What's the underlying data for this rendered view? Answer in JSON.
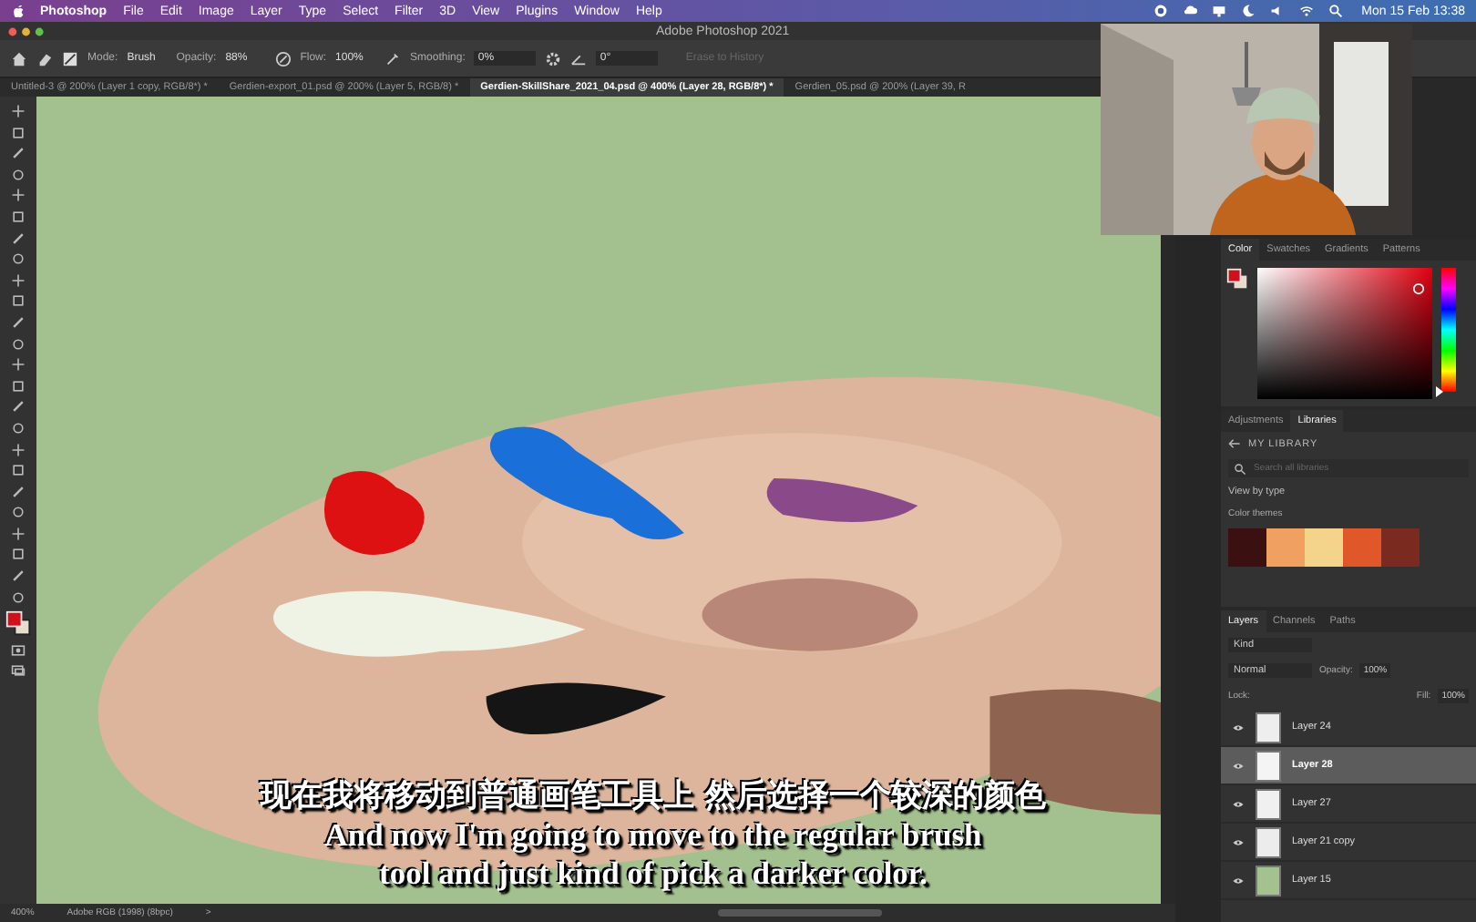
{
  "menu_bar": {
    "app": "Photoshop",
    "items": [
      "File",
      "Edit",
      "Image",
      "Layer",
      "Type",
      "Select",
      "Filter",
      "3D",
      "View",
      "Plugins",
      "Window",
      "Help"
    ],
    "clock": "Mon 15 Feb  13:38"
  },
  "window": {
    "title": "Adobe Photoshop 2021"
  },
  "options_bar": {
    "mode_label": "Mode:",
    "mode": "Brush",
    "opacity_label": "Opacity:",
    "opacity": "88%",
    "flow_label": "Flow:",
    "flow": "100%",
    "smoothing_label": "Smoothing:",
    "smoothing": "0%",
    "angle": "0°",
    "history": {
      "label": "Erase to History",
      "disabled": true
    }
  },
  "doc_tabs": [
    {
      "label": "Untitled-3 @ 200% (Layer 1 copy, RGB/8*) *",
      "selected": false
    },
    {
      "label": "Gerdien-export_01.psd @ 200% (Layer 5, RGB/8) *",
      "selected": false
    },
    {
      "label": "Gerdien-SkillShare_2021_04.psd @ 400% (Layer 28, RGB/8*) *",
      "selected": true
    },
    {
      "label": "Gerdien_05.psd @ 200% (Layer 39, R",
      "selected": false
    }
  ],
  "subtitles": [
    "现在我将移动到普通画笔工具上 然后选择一个较深的颜色",
    "And now I'm going to move to the regular brush",
    "tool and just kind of pick a darker color."
  ],
  "status_bar": {
    "zoom": "400%",
    "profile": "Adobe RGB (1998) (8bpc)",
    "arrow": ">"
  },
  "color_panel": {
    "tabs": [
      {
        "label": "Color",
        "selected": true
      },
      {
        "label": "Swatches",
        "selected": false
      },
      {
        "label": "Gradients",
        "selected": false
      },
      {
        "label": "Patterns",
        "selected": false
      }
    ],
    "hue": {
      "level": 0
    }
  },
  "libraries_panel": {
    "tabs": [
      {
        "label": "Adjustments",
        "selected": false
      },
      {
        "label": "Libraries",
        "selected": true
      }
    ],
    "library": "MY LIBRARY",
    "search": {
      "placeholder": "Search all libraries"
    },
    "view": "View by type",
    "section": "Color themes",
    "theme": [
      {
        "color": "#3a1010"
      },
      {
        "color": "#f0a060"
      },
      {
        "color": "#f3d48a"
      },
      {
        "color": "#e0582a"
      },
      {
        "color": "#7a2a1e"
      }
    ]
  },
  "layers_panel": {
    "tabs": [
      {
        "label": "Layers",
        "selected": true
      },
      {
        "label": "Channels",
        "selected": false
      },
      {
        "label": "Paths",
        "selected": false
      }
    ],
    "filter": "Kind",
    "blend": "Normal",
    "opacity_label": "Opacity:",
    "opacity": "100%",
    "lock_label": "Lock:",
    "fill_label": "Fill:",
    "fill": "100%",
    "layers": [
      {
        "name": "Layer 24",
        "visible": true,
        "selected": false,
        "color": "#eeeeee"
      },
      {
        "name": "Layer 28",
        "visible": true,
        "selected": true,
        "color": "#f4f4f4"
      },
      {
        "name": "Layer 27",
        "visible": true,
        "selected": false,
        "color": "#f0f0f0"
      },
      {
        "name": "Layer 21 copy",
        "visible": true,
        "selected": false,
        "color": "#ececec"
      },
      {
        "name": "Layer 15",
        "visible": true,
        "selected": false,
        "color": "#a3c28f"
      }
    ]
  }
}
